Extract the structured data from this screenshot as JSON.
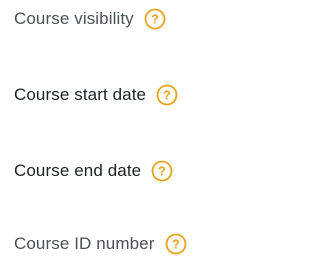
{
  "form": {
    "fields": [
      {
        "label": "Course visibility",
        "help_icon": "question-circle-icon"
      },
      {
        "label": "Course start date",
        "help_icon": "question-circle-icon"
      },
      {
        "label": "Course end date",
        "help_icon": "question-circle-icon"
      },
      {
        "label": "Course ID number",
        "help_icon": "question-circle-icon"
      }
    ],
    "help_icon_color": "#e8a31a",
    "help_glyph": "?"
  }
}
